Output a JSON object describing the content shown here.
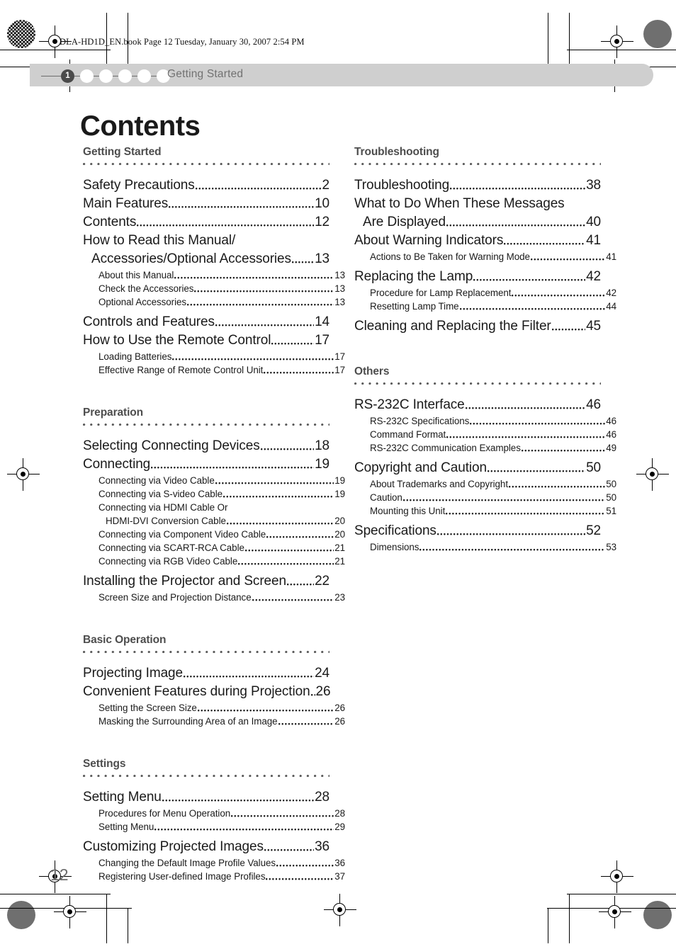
{
  "print_marks": {
    "file_line": "DLA-HD1D_EN.book  Page 12  Tuesday, January 30, 2007  2:54 PM"
  },
  "header": {
    "chapter_number": "1",
    "chapter_title": "Getting Started",
    "bubble_count": 6
  },
  "page": {
    "title": "Contents",
    "folio": "12"
  },
  "toc": {
    "left_column": [
      {
        "heading": "Getting Started",
        "entries": [
          {
            "level": 1,
            "text": "Safety Precautions",
            "page": "2"
          },
          {
            "level": 1,
            "text": "Main Features",
            "page": "10"
          },
          {
            "level": 1,
            "text": "Contents",
            "page": "12"
          },
          {
            "level": 1,
            "text": "How to Read this Manual/",
            "page": ""
          },
          {
            "level": 1,
            "cont": true,
            "text": "Accessories/Optional Accessories",
            "page": "13"
          },
          {
            "level": 2,
            "text": "About this Manual",
            "page": "13"
          },
          {
            "level": 2,
            "text": "Check the Accessories",
            "page": "13"
          },
          {
            "level": 2,
            "text": "Optional Accessories",
            "page": "13"
          },
          {
            "level": 1,
            "text": "Controls and Features",
            "page": "14"
          },
          {
            "level": 1,
            "text": "How to Use the Remote Control",
            "page": "17"
          },
          {
            "level": 2,
            "text": "Loading Batteries",
            "page": "17"
          },
          {
            "level": 2,
            "text": "Effective Range of Remote Control Unit",
            "page": "17"
          }
        ]
      },
      {
        "heading": "Preparation",
        "entries": [
          {
            "level": 1,
            "text": "Selecting Connecting Devices",
            "page": "18"
          },
          {
            "level": 1,
            "text": "Connecting",
            "page": "19"
          },
          {
            "level": 2,
            "text": "Connecting via Video Cable",
            "page": "19"
          },
          {
            "level": 2,
            "text": "Connecting via S-video Cable",
            "page": "19"
          },
          {
            "level": 2,
            "text": "Connecting via HDMI Cable Or",
            "page": ""
          },
          {
            "level": 2,
            "cont": true,
            "text": "HDMI-DVI Conversion Cable",
            "page": "20"
          },
          {
            "level": 2,
            "text": "Connecting via Component Video Cable",
            "page": "20"
          },
          {
            "level": 2,
            "text": "Connecting via SCART-RCA Cable",
            "page": "21"
          },
          {
            "level": 2,
            "text": "Connecting via RGB Video Cable",
            "page": "21"
          },
          {
            "level": 1,
            "text": "Installing the Projector and Screen",
            "page": "22"
          },
          {
            "level": 2,
            "text": "Screen Size and Projection Distance",
            "page": "23"
          }
        ]
      },
      {
        "heading": "Basic Operation",
        "entries": [
          {
            "level": 1,
            "text": "Projecting Image",
            "page": "24"
          },
          {
            "level": 1,
            "text": "Convenient Features during Projection",
            "page": "26"
          },
          {
            "level": 2,
            "text": "Setting the Screen Size",
            "page": "26"
          },
          {
            "level": 2,
            "text": "Masking the Surrounding Area of an Image",
            "page": "26"
          }
        ]
      },
      {
        "heading": "Settings",
        "entries": [
          {
            "level": 1,
            "text": "Setting Menu",
            "page": "28"
          },
          {
            "level": 2,
            "text": "Procedures for Menu Operation",
            "page": "28"
          },
          {
            "level": 2,
            "text": "Setting Menu",
            "page": "29"
          },
          {
            "level": 1,
            "text": "Customizing Projected Images",
            "page": "36"
          },
          {
            "level": 2,
            "text": "Changing the Default Image Profile Values",
            "page": "36"
          },
          {
            "level": 2,
            "text": "Registering User-defined Image Profiles",
            "page": "37"
          }
        ]
      }
    ],
    "right_column": [
      {
        "heading": "Troubleshooting",
        "entries": [
          {
            "level": 1,
            "text": "Troubleshooting",
            "page": "38"
          },
          {
            "level": 1,
            "text": "What to Do When These Messages",
            "page": ""
          },
          {
            "level": 1,
            "cont": true,
            "text": "Are Displayed",
            "page": "40"
          },
          {
            "level": 1,
            "text": "About Warning Indicators",
            "page": "41"
          },
          {
            "level": 2,
            "text": "Actions to Be Taken for Warning Mode",
            "page": "41"
          },
          {
            "level": 1,
            "text": "Replacing the Lamp",
            "page": "42"
          },
          {
            "level": 2,
            "text": "Procedure for Lamp Replacement",
            "page": "42"
          },
          {
            "level": 2,
            "text": "Resetting Lamp Time",
            "page": "44"
          },
          {
            "level": 1,
            "text": "Cleaning and Replacing the Filter",
            "page": "45"
          }
        ]
      },
      {
        "heading": "Others",
        "entries": [
          {
            "level": 1,
            "text": "RS-232C Interface",
            "page": "46"
          },
          {
            "level": 2,
            "text": "RS-232C Specifications",
            "page": "46"
          },
          {
            "level": 2,
            "text": "Command Format",
            "page": "46"
          },
          {
            "level": 2,
            "text": "RS-232C Communication Examples",
            "page": "49"
          },
          {
            "level": 1,
            "text": "Copyright and Caution",
            "page": "50"
          },
          {
            "level": 2,
            "text": "About Trademarks and Copyright",
            "page": "50"
          },
          {
            "level": 2,
            "text": "Caution",
            "page": "50"
          },
          {
            "level": 2,
            "text": "Mounting this Unit",
            "page": "51"
          },
          {
            "level": 1,
            "text": "Specifications",
            "page": "52"
          },
          {
            "level": 2,
            "text": "Dimensions",
            "page": "53"
          }
        ]
      }
    ]
  }
}
